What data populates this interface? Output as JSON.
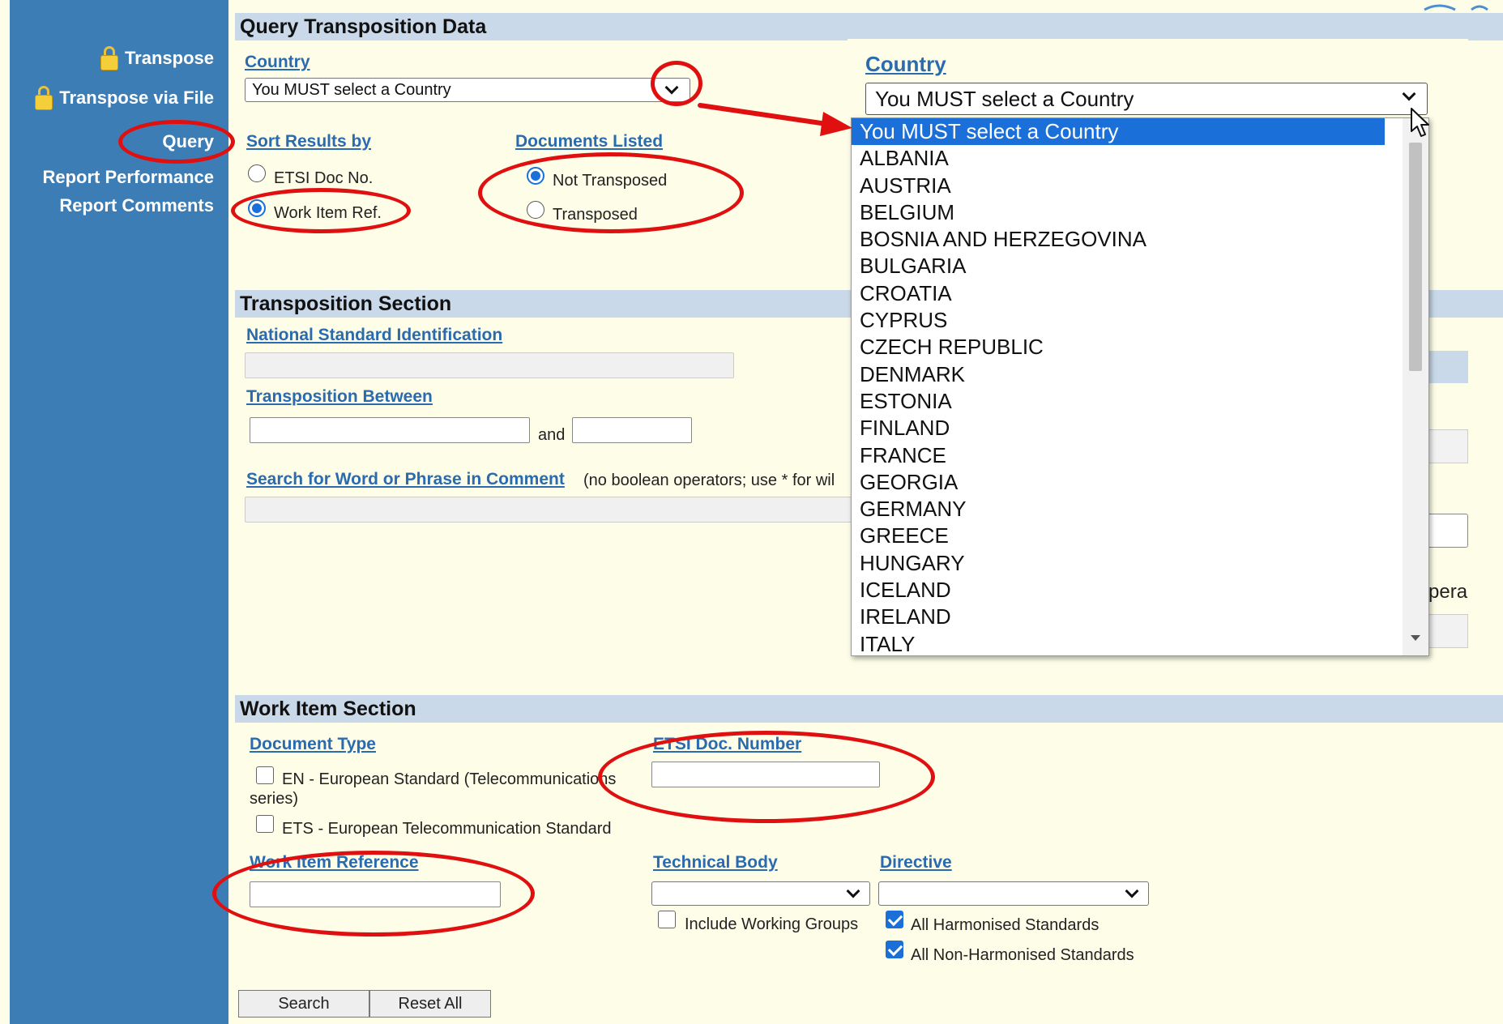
{
  "sidebar": {
    "items": [
      {
        "label": "Transpose"
      },
      {
        "label": "Transpose via File"
      },
      {
        "label": "Query"
      },
      {
        "label": "Report Performance"
      },
      {
        "label": "Report Comments"
      }
    ]
  },
  "query": {
    "title": "Query Transposition Data",
    "country_label": "Country",
    "country_value": "You MUST select a Country",
    "sort_label": "Sort Results by",
    "sort_options": [
      "ETSI Doc No.",
      "Work Item Ref."
    ],
    "sort_selected": "Work Item Ref.",
    "docs_label": "Documents Listed",
    "docs_options": [
      "Not Transposed",
      "Transposed"
    ],
    "docs_selected": "Not Transposed"
  },
  "transposition": {
    "title": "Transposition Section",
    "national_std_label": "National Standard Identification",
    "between_label": "Transposition Between",
    "and_label": "and",
    "search_label": "Search for Word or Phrase in Comment",
    "search_hint": "(no boolean operators; use * for wil",
    "hidden_fragment": "pera"
  },
  "workitem": {
    "title": "Work Item Section",
    "doc_type_label": "Document Type",
    "doc_types": [
      "EN - European Standard (Telecommunications series)",
      "ETS - European Telecommunication Standard"
    ],
    "etsi_doc_label": "ETSI Doc. Number",
    "work_item_ref_label": "Work Item Reference",
    "tech_body_label": "Technical Body",
    "directive_label": "Directive",
    "include_wg_label": "Include Working Groups",
    "all_harmonised_label": "All Harmonised Standards",
    "all_non_harmonised_label": "All Non-Harmonised Standards"
  },
  "buttons": {
    "search": "Search",
    "reset": "Reset All"
  },
  "zoom_country": {
    "label": "Country",
    "value": "You MUST select a Country",
    "options": [
      "You MUST select a Country",
      "ALBANIA",
      "AUSTRIA",
      "BELGIUM",
      "BOSNIA AND HERZEGOVINA",
      "BULGARIA",
      "CROATIA",
      "CYPRUS",
      "CZECH REPUBLIC",
      "DENMARK",
      "ESTONIA",
      "FINLAND",
      "FRANCE",
      "GEORGIA",
      "GERMANY",
      "GREECE",
      "HUNGARY",
      "ICELAND",
      "IRELAND",
      "ITALY"
    ]
  },
  "colors": {
    "sidebar": "#3d7db5",
    "page_bg": "#fdfde8",
    "section_bg": "#c9d9e9",
    "link": "#2a6bb0",
    "annotation_red": "#e01010",
    "selected_blue": "#1a6fd9"
  },
  "icons": [
    "lock-icon",
    "chevron-down-icon",
    "arrow-annotation-icon",
    "mouse-cursor-icon"
  ]
}
